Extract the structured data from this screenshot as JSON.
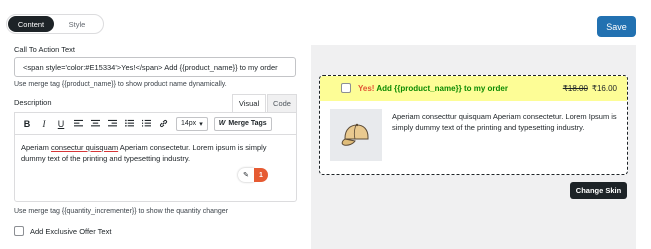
{
  "tabs": {
    "content": "Content",
    "style": "Style"
  },
  "save_label": "Save",
  "cta": {
    "label": "Call To Action Text",
    "value": "<span style='color:#E15334'>Yes!</span> Add {{product_name}} to my order",
    "help": "Use merge tag {{product_name}} to show product name dynamically."
  },
  "description": {
    "label": "Description",
    "tab_visual": "Visual",
    "tab_code": "Code",
    "font_size": "14px",
    "merge_tags_label": "Merge Tags",
    "text_before": "Aperiam ",
    "text_underlined": "consectur quisquam",
    "text_after": " Aperiam consectetur. Lorem ipsum is simply dummy text of the printing and typesetting industry.",
    "grammar_count": "1"
  },
  "quantity_help": "Use merge tag {{quantity_incrementer}} to show the quantity changer",
  "exclusive_offer_label": "Add Exclusive Offer Text",
  "preview": {
    "cta_yes": "Yes!",
    "cta_rest": " Add {{product_name}} to my order",
    "price_old": "₹18.00",
    "price_new": "₹16.00",
    "description": "Aperiam consecttur quisquam Aperiam consectetur. Lorem Ipsum is simply dummy text of the printing and typesetting industry.",
    "change_skin": "Change Skin"
  },
  "colors": {
    "accent": "#2271b1",
    "cta_red": "#E15334",
    "cta_green": "#0b8a00",
    "highlight": "#fdfd96"
  }
}
